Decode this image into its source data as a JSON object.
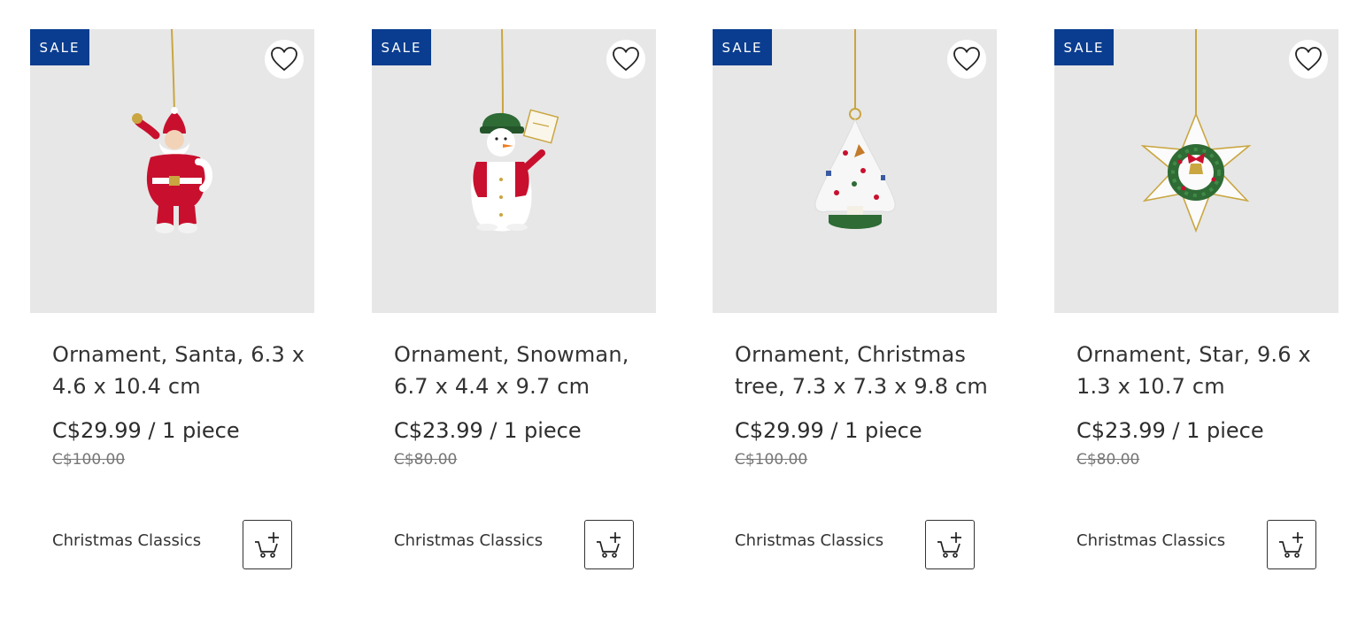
{
  "products": [
    {
      "badge": "SALE",
      "image_subject": "santa-ornament",
      "title": "Ornament, Santa, 6.3 x 4.6 x 10.4 cm",
      "price": "C$29.99 / 1 piece",
      "old_price": "C$100.00",
      "collection": "Christmas Classics",
      "icons": {
        "wishlist": "heart-outline-icon",
        "cart": "cart-add-icon"
      }
    },
    {
      "badge": "SALE",
      "image_subject": "snowman-ornament",
      "title": "Ornament, Snowman, 6.7 x 4.4 x 9.7 cm",
      "price": "C$23.99 / 1 piece",
      "old_price": "C$80.00",
      "collection": "Christmas Classics",
      "icons": {
        "wishlist": "heart-outline-icon",
        "cart": "cart-add-icon"
      }
    },
    {
      "badge": "SALE",
      "image_subject": "christmas-tree-ornament",
      "title": "Ornament, Christmas tree, 7.3 x 7.3 x 9.8 cm",
      "price": "C$29.99 / 1 piece",
      "old_price": "C$100.00",
      "collection": "Christmas Classics",
      "icons": {
        "wishlist": "heart-outline-icon",
        "cart": "cart-add-icon"
      }
    },
    {
      "badge": "SALE",
      "image_subject": "star-wreath-ornament",
      "title": "Ornament, Star, 9.6 x 1.3 x 10.7 cm",
      "price": "C$23.99 / 1 piece",
      "old_price": "C$80.00",
      "collection": "Christmas Classics",
      "icons": {
        "wishlist": "heart-outline-icon",
        "cart": "cart-add-icon"
      }
    }
  ],
  "colors": {
    "sale_badge": "#0a3d8f",
    "image_bg": "#e7e7e7",
    "text": "#333333",
    "old_price": "#777777"
  }
}
